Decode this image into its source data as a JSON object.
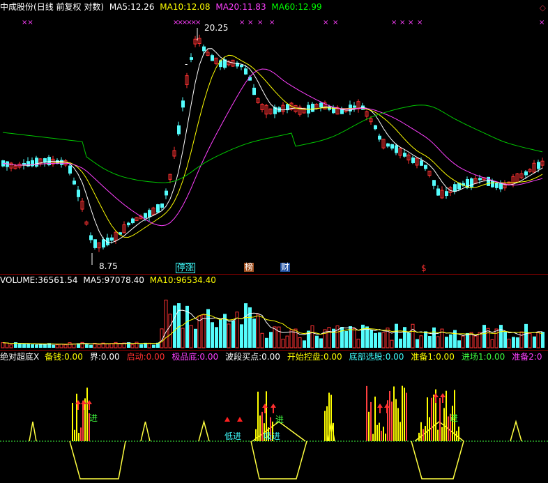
{
  "title": {
    "stock_name": "中成股份",
    "mode": "(日线 前复权 对数)",
    "ma5_label": "MA5:",
    "ma5_value": "12.26",
    "ma10_label": "MA10:",
    "ma10_value": "12.08",
    "ma20_label": "MA20:",
    "ma20_value": "11.83",
    "ma60_label": "MA60:",
    "ma60_value": "12.99"
  },
  "price_chart": {
    "high_label": "20.25",
    "low_label": "8.75",
    "dash_mark": "-",
    "events": {
      "limit_up": "停涨",
      "list": "榜",
      "finance": "财",
      "dollar": "$"
    },
    "x_marks": [
      "××",
      "××××××",
      "×",
      "×",
      "×",
      "×",
      "×",
      "×",
      "×",
      "×",
      "×",
      "×",
      "×"
    ]
  },
  "volume": {
    "label": "VOLUME:",
    "value": "36561.54",
    "ma5_label": "MA5:",
    "ma5_value": "97078.40",
    "ma10_label": "MA10:",
    "ma10_value": "96534.40"
  },
  "indicator": {
    "name": "绝对超底X",
    "items": [
      {
        "label": "备钱:",
        "value": "0.00",
        "color": "#ffff00"
      },
      {
        "label": "界:",
        "value": "0.00",
        "color": "#ffffff"
      },
      {
        "label": "启动:",
        "value": "0.00",
        "color": "#ff3030"
      },
      {
        "label": "极品底:",
        "value": "0.00",
        "color": "#ff40ff"
      },
      {
        "label": "波段买点:",
        "value": "0.00",
        "color": "#ffffff"
      },
      {
        "label": "开始控盘:",
        "value": "0.00",
        "color": "#ffff00"
      },
      {
        "label": "底部选股:",
        "value": "0.00",
        "color": "#40ffff"
      },
      {
        "label": "准备1:",
        "value": "0.00",
        "color": "#ffff00"
      },
      {
        "label": "进场1:",
        "value": "0.00",
        "color": "#40ff40"
      },
      {
        "label": "准备2:",
        "value": "0",
        "color": "#ff40ff"
      }
    ],
    "signals": {
      "low_in": "低进",
      "bottom_in": "低进",
      "absorb": "吸进",
      "enter": "进"
    }
  },
  "colors": {
    "up": "#ff3232",
    "down": "#54fcfc",
    "ma5": "#ffffff",
    "ma10": "#ffff00",
    "ma20": "#ff40ff",
    "ma60": "#00c800"
  }
}
